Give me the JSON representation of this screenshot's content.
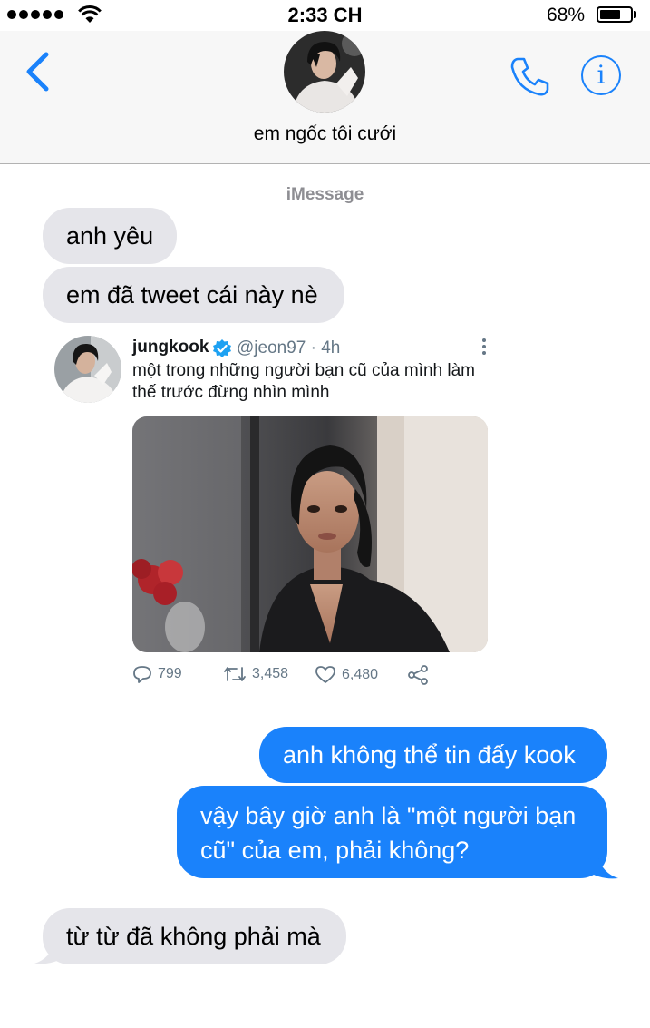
{
  "status": {
    "time": "2:33 CH",
    "battery_pct": "68%",
    "battery_level": 0.68,
    "signal_bars": 5
  },
  "header": {
    "contact_name": "em ngốc tôi cưới",
    "back_icon": "chevron-left-icon",
    "call_icon": "phone-icon",
    "info_icon": "info-icon",
    "accent_color": "#1a82fb"
  },
  "thread": {
    "service_label": "iMessage",
    "messages": [
      {
        "from": "them",
        "text": "anh yêu"
      },
      {
        "from": "them",
        "text": "em đã tweet cái này nè"
      },
      {
        "from": "me",
        "text": "anh không thể tin đấy kook"
      },
      {
        "from": "me",
        "text": "vậy bây giờ anh là \"một người bạn cũ\" của em, phải không?"
      },
      {
        "from": "them",
        "text": "từ từ đã không phải mà"
      }
    ],
    "me_bubble_line1": "vậy bây giờ anh là \"một người bạn",
    "me_bubble_line2": "cũ\" của em, phải không?"
  },
  "tweet": {
    "name": "jungkook",
    "handle_time": "@jeon97 · 4h",
    "text": "một trong những người bạn cũ của mình làm thế trước đừng nhìn mình",
    "replies": "799",
    "retweets": "3,458",
    "likes": "6,480",
    "verified": true
  },
  "colors": {
    "incoming_bubble": "#e5e5ea",
    "outgoing_bubble": "#1a82fb",
    "twitter_blue": "#1da1f2"
  }
}
